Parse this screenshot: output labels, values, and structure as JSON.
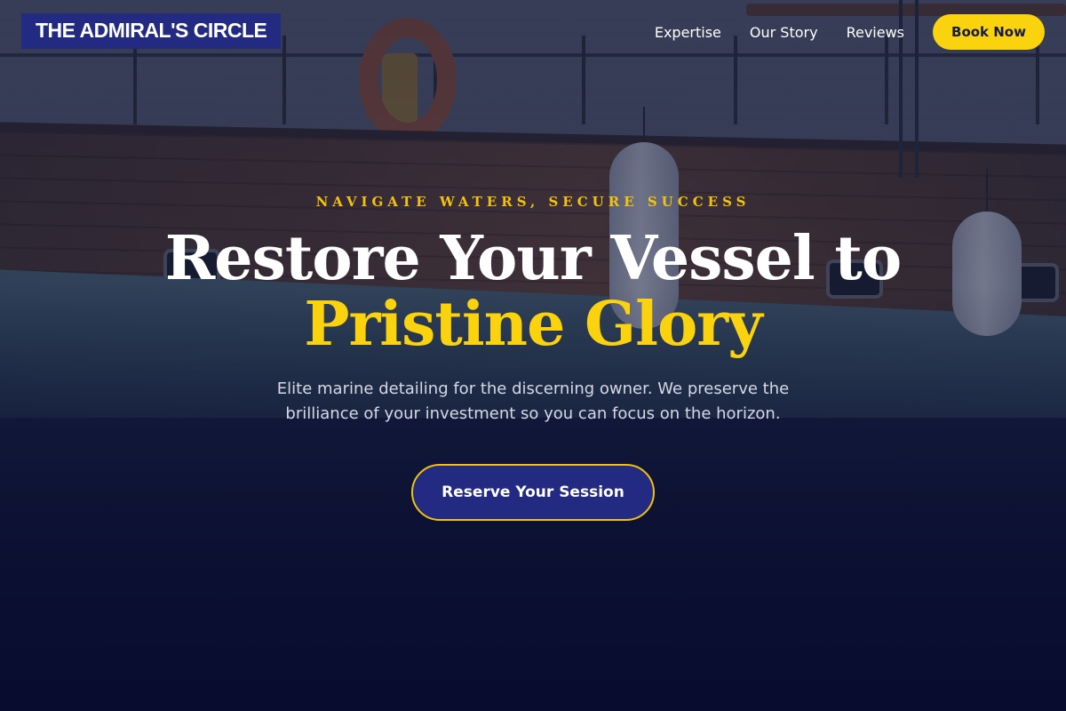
{
  "brand": {
    "name": "THE ADMIRAL'S CIRCLE"
  },
  "nav": {
    "links": [
      {
        "label": "Expertise"
      },
      {
        "label": "Our Story"
      },
      {
        "label": "Reviews"
      }
    ],
    "cta_label": "Book Now"
  },
  "hero": {
    "eyebrow": "NAVIGATE WATERS, SECURE SUCCESS",
    "headline_line1": "Restore Your Vessel to",
    "headline_line2": "Pristine Glory",
    "subtext": "Elite marine detailing for the discerning owner. We preserve the brilliance of your investment so you can focus on the horizon.",
    "cta_label": "Reserve Your Session"
  },
  "colors": {
    "brand_navy": "#222a82",
    "accent_gold": "#fbd20e",
    "page_dark": "#0b1030"
  }
}
